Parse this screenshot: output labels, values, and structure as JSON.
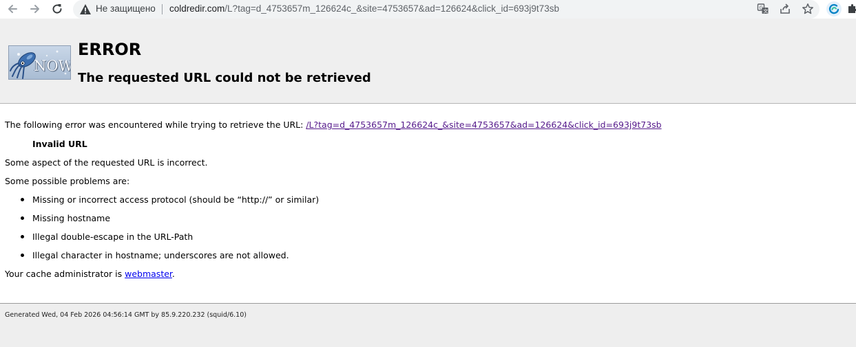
{
  "browser": {
    "security_label": "Не защищено",
    "url_host": "coldredir.com",
    "url_rest": "/L?tag=d_4753657m_126624c_&site=4753657&ad=126624&click_id=693j9t73sb"
  },
  "header": {
    "logo_text": "NOW",
    "title": "ERROR",
    "subtitle": "The requested URL could not be retrieved"
  },
  "body": {
    "intro": "The following error was encountered while trying to retrieve the URL: ",
    "url_link": "/L?tag=d_4753657m_126624c_&site=4753657&ad=126624&click_id=693j9t73sb",
    "error_name": "Invalid URL",
    "description": "Some aspect of the requested URL is incorrect.",
    "problems_heading": "Some possible problems are:",
    "problems": [
      "Missing or incorrect access protocol (should be “http://” or similar)",
      "Missing hostname",
      "Illegal double-escape in the URL-Path",
      "Illegal character in hostname; underscores are not allowed."
    ],
    "admin_prefix": "Your cache administrator is ",
    "admin_link": "webmaster",
    "admin_suffix": "."
  },
  "footer": {
    "generated": "Generated Wed, 04 Feb 2026 04:56:14 GMT by 85.9.220.232 (squid/6.10)"
  },
  "icons": {
    "back": "back-arrow-icon",
    "forward": "forward-arrow-icon",
    "reload": "reload-icon",
    "warning": "warning-icon",
    "translate": "translate-icon",
    "share": "share-icon",
    "bookmark": "star-icon",
    "extension": "edge-extension-icon",
    "puzzle": "puzzle-icon"
  },
  "colors": {
    "link_visited": "#551a8b",
    "link": "#0000ee",
    "page_bg": "#eeeeee",
    "content_bg": "#ffffff"
  }
}
